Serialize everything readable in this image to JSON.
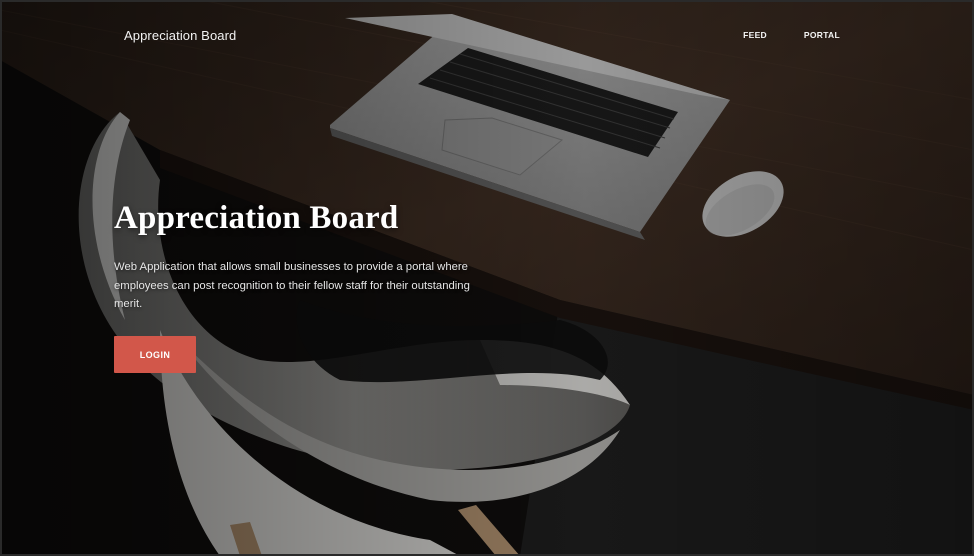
{
  "navbar": {
    "brand": "Appreciation Board",
    "links": [
      {
        "label": "FEED"
      },
      {
        "label": "PORTAL"
      }
    ]
  },
  "hero": {
    "title": "Appreciation Board",
    "description": "Web Application that allows small businesses to provide a portal where employees can post recognition to their fellow staff for their outstanding merit.",
    "login_label": "LOGIN"
  },
  "colors": {
    "accent": "#d2574a",
    "text": "#ffffff",
    "background": "#100e0d"
  }
}
